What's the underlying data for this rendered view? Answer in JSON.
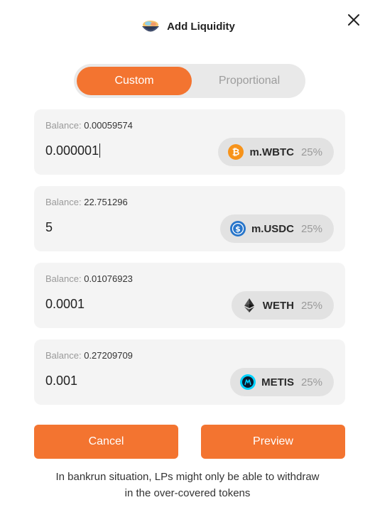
{
  "header": {
    "title": "Add Liquidity"
  },
  "toggle": {
    "custom": "Custom",
    "proportional": "Proportional"
  },
  "tokens": [
    {
      "balance_label": "Balance:",
      "balance": "0.00059574",
      "amount": "0.000001",
      "symbol": "m.WBTC",
      "weight": "25%",
      "icon": "bitcoin-icon"
    },
    {
      "balance_label": "Balance:",
      "balance": "22.751296",
      "amount": "5",
      "symbol": "m.USDC",
      "weight": "25%",
      "icon": "usdc-icon"
    },
    {
      "balance_label": "Balance:",
      "balance": "0.01076923",
      "amount": "0.0001",
      "symbol": "WETH",
      "weight": "25%",
      "icon": "ethereum-icon"
    },
    {
      "balance_label": "Balance:",
      "balance": "0.27209709",
      "amount": "0.001",
      "symbol": "METIS",
      "weight": "25%",
      "icon": "metis-icon"
    }
  ],
  "actions": {
    "cancel": "Cancel",
    "preview": "Preview"
  },
  "note": {
    "line1": "In bankrun situation, LPs might only be able to withdraw",
    "line2": "in the over-covered tokens"
  },
  "colors": {
    "accent": "#f37430",
    "card": "#f4f4f4",
    "pill": "#e2e2e2"
  }
}
